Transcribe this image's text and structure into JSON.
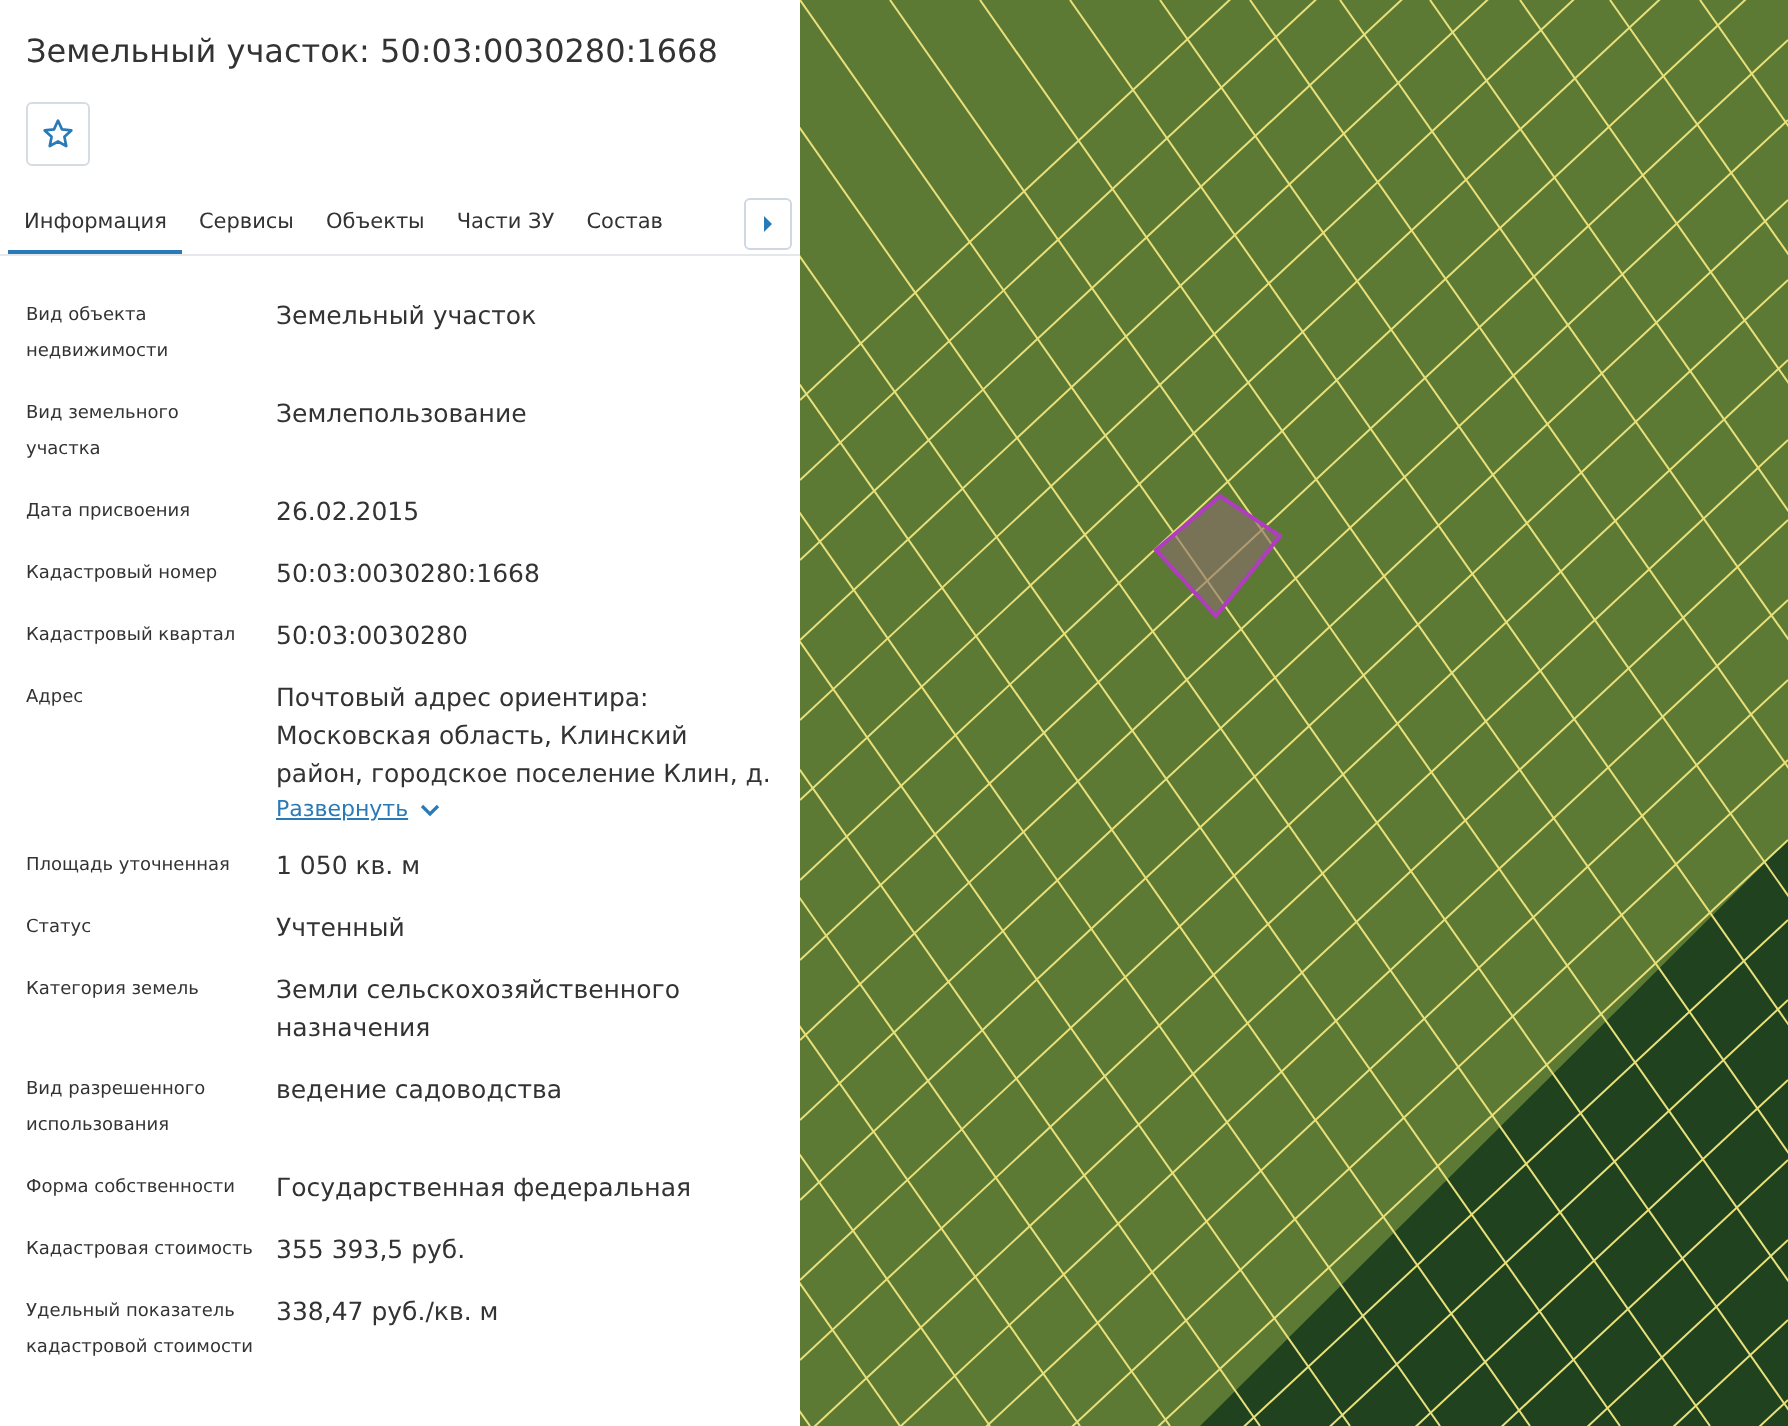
{
  "title": "Земельный участок: 50:03:0030280:1668",
  "favorite": {
    "selected": false
  },
  "tabs": [
    {
      "label": "Информация",
      "selected": true
    },
    {
      "label": "Сервисы",
      "selected": false
    },
    {
      "label": "Объекты",
      "selected": false
    },
    {
      "label": "Части ЗУ",
      "selected": false
    },
    {
      "label": "Состав",
      "selected": false
    }
  ],
  "fields": [
    {
      "label": "Вид объекта недвижимости",
      "value": "Земельный участок"
    },
    {
      "label": "Вид земельного участка",
      "value": "Землепользование"
    },
    {
      "label": "Дата присвоения",
      "value": "26.02.2015"
    },
    {
      "label": "Кадастровый номер",
      "value": "50:03:0030280:1668"
    },
    {
      "label": "Кадастровый квартал",
      "value": "50:03:0030280"
    },
    {
      "label": "Адрес",
      "value": "Почтовый адрес ориентира: Московская область, Клинский район, городское поселение Клин, д.",
      "expand_link": "Развернуть"
    },
    {
      "label": "Площадь уточненная",
      "value": "1 050 кв. м"
    },
    {
      "label": "Статус",
      "value": "Учтенный"
    },
    {
      "label": "Категория земель",
      "value": "Земли сельскохозяйственного назначения"
    },
    {
      "label": "Вид разрешенного использования",
      "value": "ведение садоводства"
    },
    {
      "label": "Форма собственности",
      "value": "Государственная федеральная"
    },
    {
      "label": "Кадастровая стоимость",
      "value": "355 393,5 руб."
    },
    {
      "label": "Удельный показатель кадастровой стоимости",
      "value": "338,47 руб./кв. м"
    }
  ]
}
